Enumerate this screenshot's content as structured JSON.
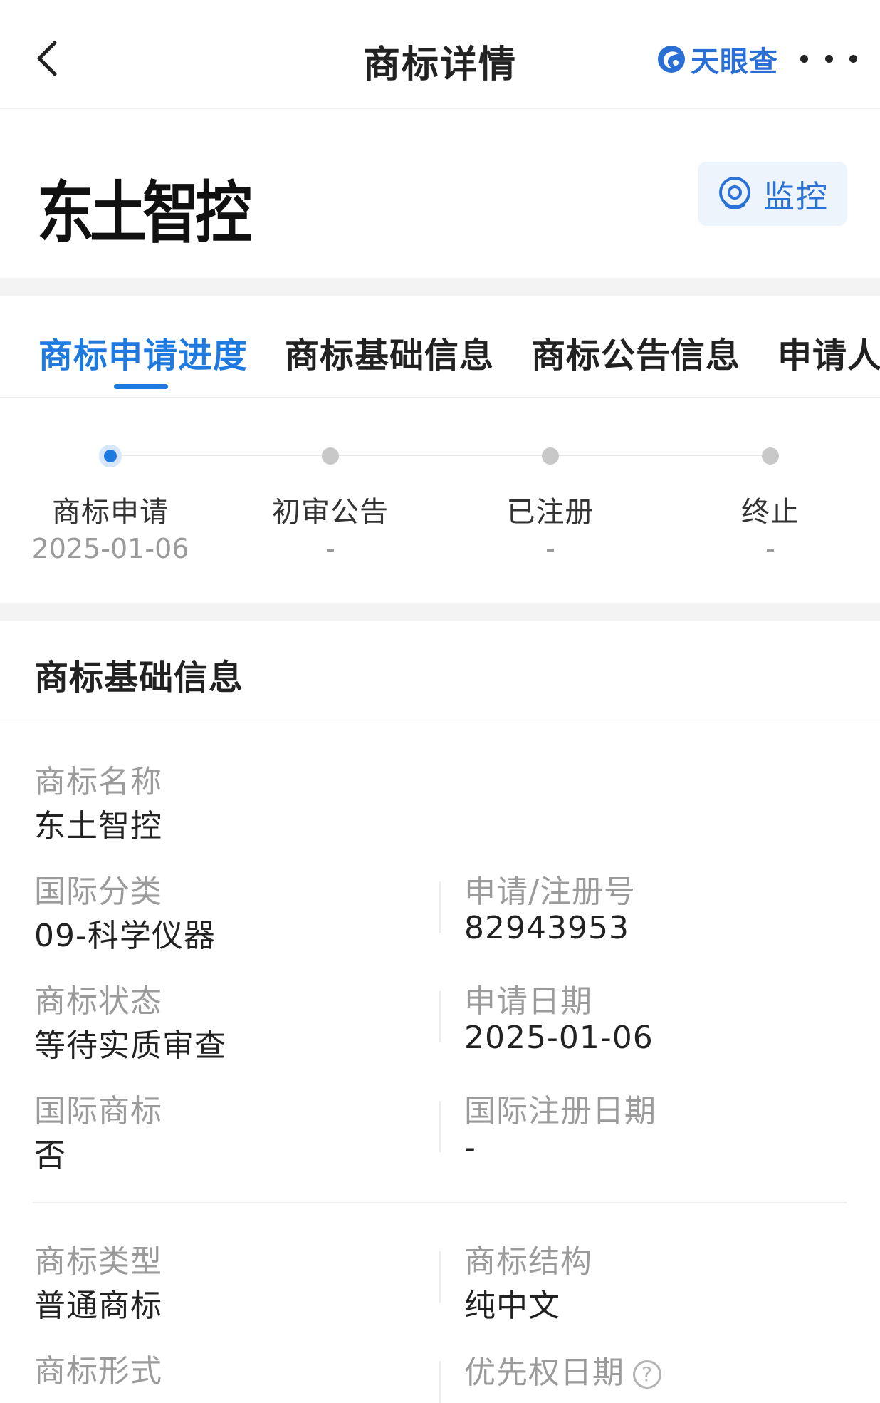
{
  "header": {
    "title": "商标详情",
    "brand": "天眼查",
    "back_icon": "chevron-left-icon",
    "more_icon": "more-horizontal-icon"
  },
  "trademark": {
    "image_text": "东土智控",
    "monitor_label": "监控",
    "monitor_icon": "target-icon"
  },
  "tabs": [
    {
      "label": "商标申请进度",
      "active": true
    },
    {
      "label": "商标基础信息",
      "active": false
    },
    {
      "label": "商标公告信息",
      "active": false
    },
    {
      "label": "申请人",
      "active": false
    }
  ],
  "progress": {
    "steps": [
      {
        "label": "商标申请",
        "date": "2025-01-06",
        "active": true
      },
      {
        "label": "初审公告",
        "date": "-",
        "active": false
      },
      {
        "label": "已注册",
        "date": "-",
        "active": false
      },
      {
        "label": "终止",
        "date": "-",
        "active": false
      }
    ]
  },
  "basic_info": {
    "title": "商标基础信息",
    "name": {
      "label": "商标名称",
      "value": "东土智控"
    },
    "intl_class": {
      "label": "国际分类",
      "value": "09-科学仪器"
    },
    "reg_no": {
      "label": "申请/注册号",
      "value": "82943953"
    },
    "status": {
      "label": "商标状态",
      "value": "等待实质审查"
    },
    "apply_date": {
      "label": "申请日期",
      "value": "2025-01-06"
    },
    "intl_trademark": {
      "label": "国际商标",
      "value": "否"
    },
    "intl_reg_date": {
      "label": "国际注册日期",
      "value": "-"
    },
    "tm_type": {
      "label": "商标类型",
      "value": "普通商标"
    },
    "tm_structure": {
      "label": "商标结构",
      "value": "纯中文"
    },
    "tm_form": {
      "label": "商标形式"
    },
    "priority_date": {
      "label": "优先权日期"
    }
  },
  "colors": {
    "accent": "#1f7ae0",
    "muted": "#9b9b9b",
    "text": "#222222",
    "divider": "#f3f3f3"
  }
}
